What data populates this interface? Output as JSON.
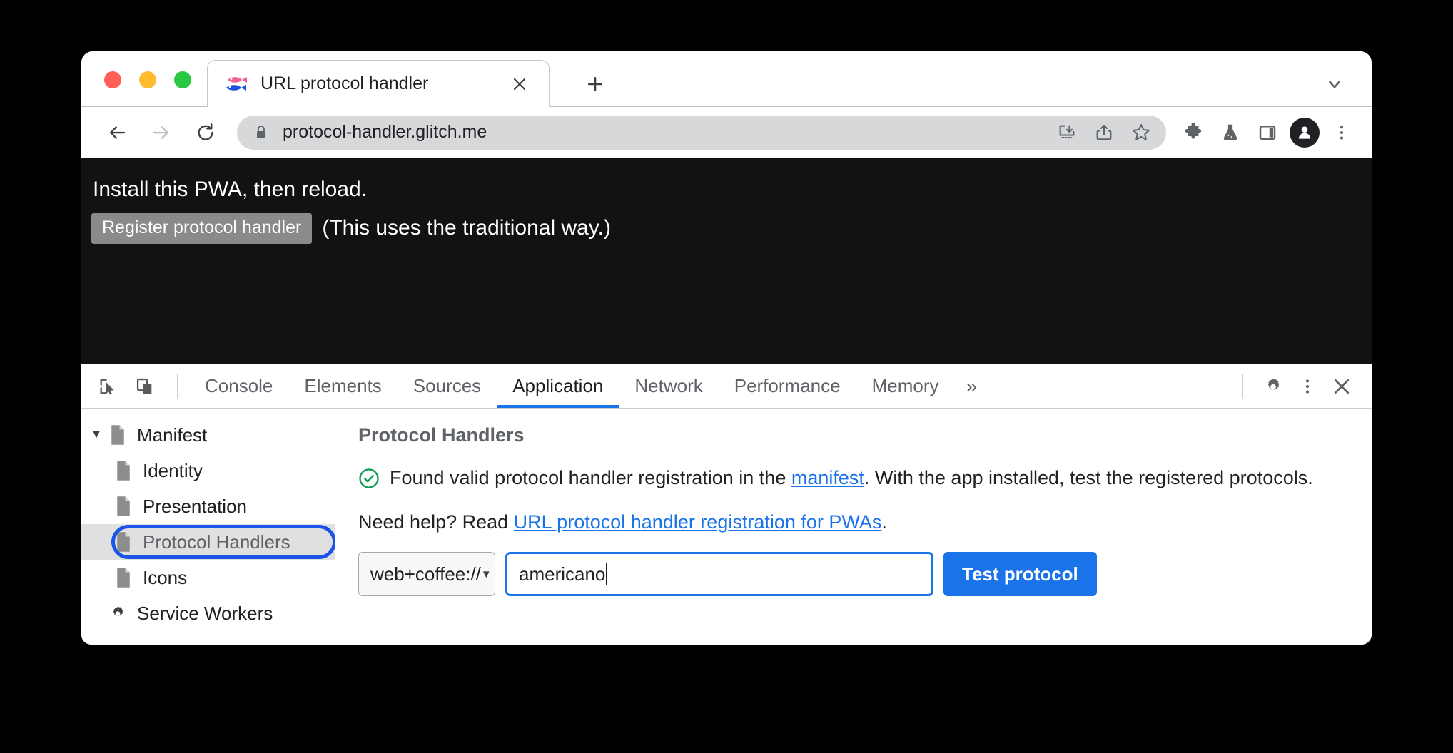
{
  "browser": {
    "traffic_lights": [
      "close",
      "minimize",
      "maximize"
    ],
    "tab": {
      "title": "URL protocol handler",
      "favicon": "fish-icon",
      "close_label": "×"
    },
    "new_tab_label": "+",
    "tabstrip_chevron": "chevron-down-icon",
    "toolbar": {
      "back": "back-arrow-icon",
      "forward": "forward-arrow-icon",
      "reload": "reload-icon",
      "lock": "lock-icon",
      "url": "protocol-handler.glitch.me",
      "omnibox_icons": [
        "install-pwa-icon",
        "share-icon",
        "bookmark-star-icon"
      ],
      "right_icons": [
        "extensions-puzzle-icon",
        "experiments-flask-icon",
        "side-panel-icon",
        "profile-avatar",
        "chrome-menu-icon"
      ]
    }
  },
  "page": {
    "heading": "Install this PWA, then reload.",
    "register_button": "Register protocol handler",
    "note": "(This uses the traditional way.)"
  },
  "devtools": {
    "left_tools": [
      "inspect-element-icon",
      "device-toolbar-icon"
    ],
    "tabs": [
      {
        "label": "Console",
        "active": false
      },
      {
        "label": "Elements",
        "active": false
      },
      {
        "label": "Sources",
        "active": false
      },
      {
        "label": "Application",
        "active": true
      },
      {
        "label": "Network",
        "active": false
      },
      {
        "label": "Performance",
        "active": false
      },
      {
        "label": "Memory",
        "active": false
      }
    ],
    "more_tabs_label": "»",
    "right_icons": [
      "settings-gear-icon",
      "devtools-menu-icon",
      "close-devtools-icon"
    ],
    "sidebar": [
      {
        "label": "Manifest",
        "icon": "manifest-file-icon",
        "level": 0,
        "expanded": true,
        "selected": false
      },
      {
        "label": "Identity",
        "icon": "file-icon",
        "level": 1,
        "selected": false
      },
      {
        "label": "Presentation",
        "icon": "file-icon",
        "level": 1,
        "selected": false
      },
      {
        "label": "Protocol Handlers",
        "icon": "file-icon",
        "level": 1,
        "selected": true
      },
      {
        "label": "Icons",
        "icon": "file-icon",
        "level": 1,
        "selected": false
      },
      {
        "label": "Service Workers",
        "icon": "gear-icon",
        "level": 0,
        "selected": false
      }
    ],
    "panel": {
      "title": "Protocol Handlers",
      "status_icon": "check-circle-icon",
      "status_prefix": "Found valid protocol handler registration in the ",
      "status_link": "manifest",
      "status_suffix": ". With the app installed, test the registered protocols.",
      "help_prefix": "Need help? Read ",
      "help_link": "URL protocol handler registration for PWAs",
      "help_suffix": ".",
      "protocol_select_value": "web+coffee://",
      "protocol_select_options": [
        "web+coffee://"
      ],
      "protocol_input_value": "americano",
      "protocol_input_placeholder": "",
      "test_button": "Test protocol"
    }
  },
  "colors": {
    "accent_blue": "#1a73e8",
    "focus_ring_blue": "#1a55e8",
    "success_green": "#0f9d58",
    "page_background": "#121212"
  }
}
